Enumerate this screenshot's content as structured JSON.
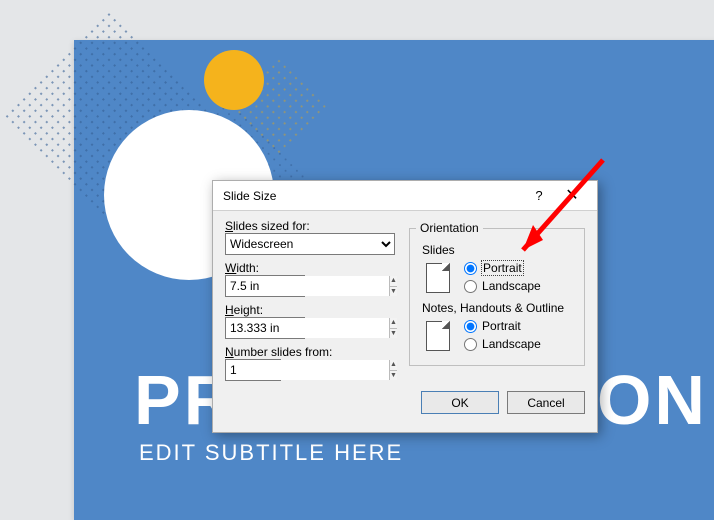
{
  "slide": {
    "title": "PRESENTATION TITLE",
    "subtitle": "EDIT SUBTITLE HERE"
  },
  "dialog": {
    "title": "Slide Size",
    "help": "?",
    "close": "✕",
    "sized_for_label": "Slides sized for:",
    "sized_for_value": "Widescreen",
    "width_label": "Width:",
    "width_value": "7.5 in",
    "height_label": "Height:",
    "height_value": "13.333 in",
    "number_label": "Number slides from:",
    "number_value": "1",
    "orientation_legend": "Orientation",
    "slides_group": "Slides",
    "notes_group": "Notes, Handouts & Outline",
    "opt_portrait": "Portrait",
    "opt_landscape": "Landscape",
    "slides_selected": "portrait",
    "notes_selected": "portrait",
    "ok": "OK",
    "cancel": "Cancel"
  }
}
